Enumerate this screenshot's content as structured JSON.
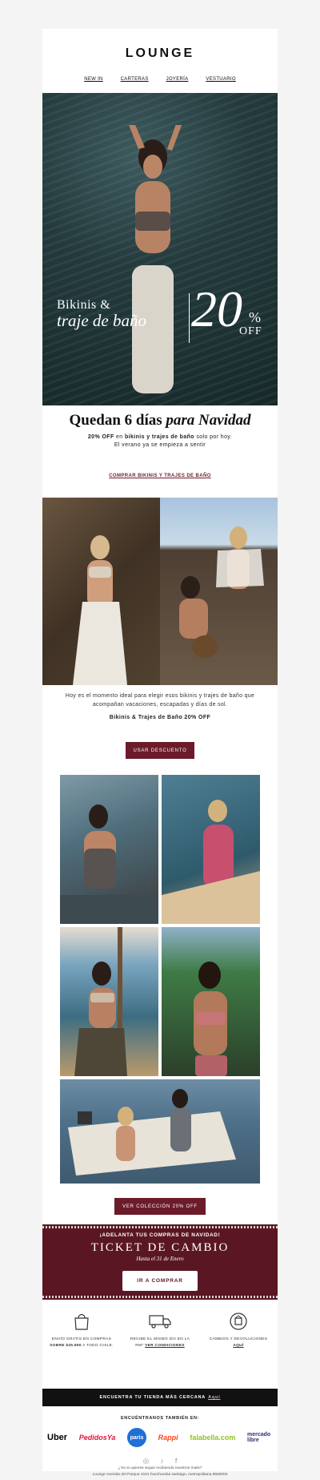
{
  "brand": {
    "logo": "LOUNGE",
    "accent": "#6b1b2a",
    "ticket_bg": "#5a1723"
  },
  "nav": [
    {
      "label": "NEW IN"
    },
    {
      "label": "CARTERAS"
    },
    {
      "label": "JOYERÍA"
    },
    {
      "label": "VESTUARIO"
    }
  ],
  "hero": {
    "line1": "Bikinis &",
    "line2": "traje de baño",
    "percent": "20",
    "percent_sign": "%",
    "off": "OFF"
  },
  "headline": {
    "plain": "Quedan 6 días",
    "italic": "para Navidad"
  },
  "sub": {
    "part1": "20% OFF",
    "part2": "en",
    "part3": "bikinis y trajes de baño",
    "part4": "solo por hoy.",
    "line2": "El verano ya se empieza a sentir"
  },
  "link_cta": "COMPRAR BIKINIS Y TRAJES DE BAÑO",
  "body_text": "Hoy es el momento ideal para elegir esos bikinis y trajes de baño que acompañan vacaciones, escapadas y días de sol.",
  "body_strong": "Bikinis & Trajes de Baño 20% OFF",
  "button_discount": "USAR DESCUENTO",
  "button_collection": "VER COLECCIÓN 20% OFF",
  "ticket": {
    "top": "¡ADELANTA TUS COMPRAS DE NAVIDAD!",
    "title": "TICKET DE CAMBIO",
    "date": "Hasta el 31 de Enero",
    "button": "IR A COMPRAR"
  },
  "benefits": [
    {
      "icon": "shopping-bag-icon",
      "line1": "ENVÍO GRATIS EN COMPRAS",
      "line2_bold": "SOBRE $25.990",
      "line2_rest": "A TODO CHILE."
    },
    {
      "icon": "delivery-truck-icon",
      "line1": "RECIBE EL MISMO DÍA EN LA",
      "line2_rest": "RM*",
      "line2_bold": "VER CONDICIONES"
    },
    {
      "icon": "exchange-box-icon",
      "line1": "CAMBIOS Y DEVOLUCIONES",
      "line2_bold": "AQUÍ"
    }
  ],
  "store_bar": {
    "text": "ENCUENTRA TU TIENDA MÁS CERCANA",
    "link": "Aquí"
  },
  "also_title": "ENCUÉNTRANOS TAMBIÉN EN:",
  "partners": [
    {
      "name": "Uber",
      "color": "#000000"
    },
    {
      "name": "PedidosYa",
      "color": "#e0163b"
    },
    {
      "name": "paris",
      "color": "#1f6fd6"
    },
    {
      "name": "Rappi",
      "color": "#ff441f"
    },
    {
      "name": "falabella.com",
      "color": "#90c31f"
    },
    {
      "name": "mercado libre",
      "color": "#2d3277"
    }
  ],
  "social": [
    "instagram-icon",
    "tiktok-icon",
    "facebook-icon"
  ],
  "footer": {
    "line1": "¿Ya no quieres seguir recibiendo nuestros mails?",
    "line2": "Lounge Avenida del Parque 4161 huechuraba santiago, metropolitana 8580000"
  }
}
